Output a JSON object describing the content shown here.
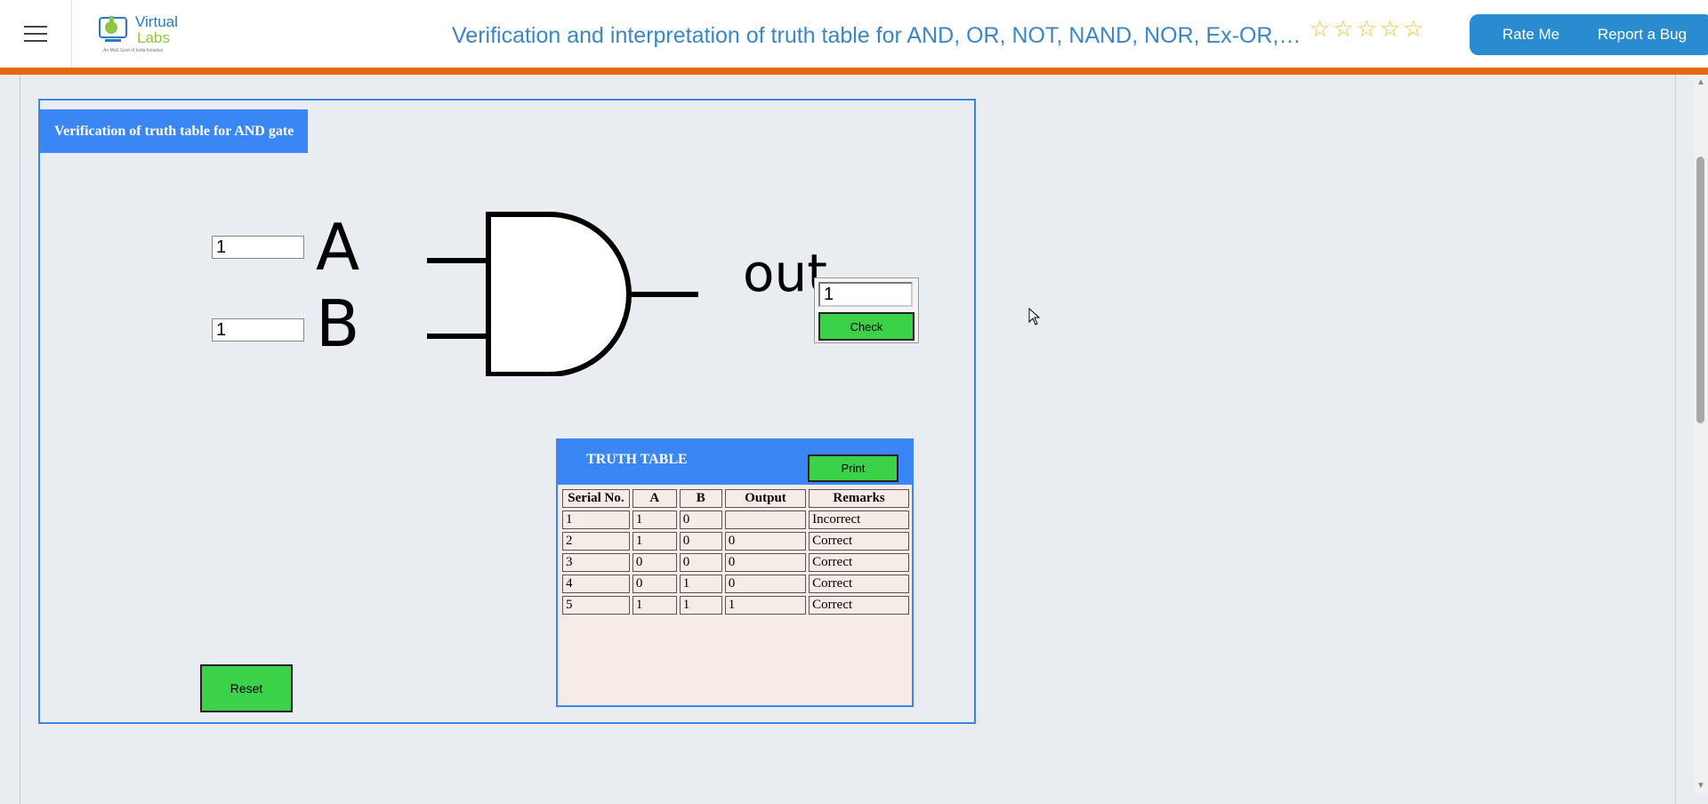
{
  "header": {
    "menu_icon": "hamburger-menu-icon",
    "logo": {
      "word1": "Virtual",
      "word2": "Labs",
      "tagline": "An MoE Govt of India Initiative"
    },
    "title": "Verification and interpretation of truth table for AND, OR, NOT, NAND, NOR, Ex-OR, Ex-NOR",
    "rating": {
      "stars": 5,
      "filled": 0
    },
    "rate_label": "Rate Me",
    "bug_label": "Report a Bug"
  },
  "experiment": {
    "title": "Verification of truth table for AND gate",
    "input_a_value": "1",
    "input_b_value": "1",
    "gate": {
      "label_a": "A",
      "label_b": "B",
      "label_out": "out"
    },
    "output_value": "1",
    "check_label": "Check",
    "reset_label": "Reset"
  },
  "truth_table": {
    "title": "TRUTH TABLE",
    "print_label": "Print",
    "columns": [
      "Serial No.",
      "A",
      "B",
      "Output",
      "Remarks"
    ],
    "rows": [
      [
        "1",
        "1",
        "0",
        "",
        "Incorrect"
      ],
      [
        "2",
        "1",
        "0",
        "0",
        "Correct"
      ],
      [
        "3",
        "0",
        "0",
        "0",
        "Correct"
      ],
      [
        "4",
        "0",
        "1",
        "0",
        "Correct"
      ],
      [
        "5",
        "1",
        "1",
        "1",
        "Correct"
      ]
    ]
  },
  "colors": {
    "accent": "#3a86f5",
    "header_border": "#e8670c",
    "button_green": "#3bd24a",
    "title_blue": "#3a86c8"
  }
}
